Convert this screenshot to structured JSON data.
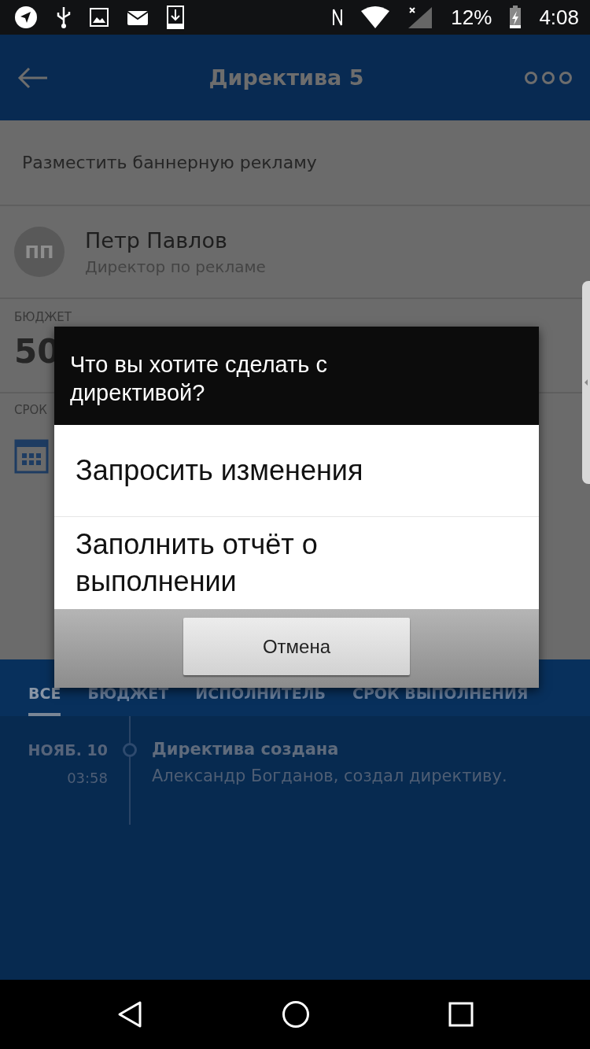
{
  "status_bar": {
    "battery": "12%",
    "time": "4:08"
  },
  "header": {
    "title": "Директива 5"
  },
  "subject": "Разместить баннерную рекламу",
  "assignee": {
    "initials": "ПП",
    "name": "Петр Павлов",
    "role": "Директор по рекламе"
  },
  "budget": {
    "label": "БЮДЖЕТ",
    "value": "50"
  },
  "deadline": {
    "label": "СРОК"
  },
  "tabs": [
    {
      "label": "ВСЕ",
      "selected": true
    },
    {
      "label": "БЮДЖЕТ",
      "selected": false
    },
    {
      "label": "ИСПОЛНИТЕЛЬ",
      "selected": false
    },
    {
      "label": "СРОК ВЫПОЛНЕНИЯ",
      "selected": false
    }
  ],
  "timeline": [
    {
      "date": "НОЯБ. 10",
      "time": "03:58",
      "title": "Директива создана",
      "text": "Александр Богданов, создал директиву."
    }
  ],
  "dialog": {
    "title": "Что вы хотите сделать с директивой?",
    "options": [
      "Запросить изменения",
      "Заполнить отчёт о выполнении"
    ],
    "cancel": "Отмена"
  }
}
